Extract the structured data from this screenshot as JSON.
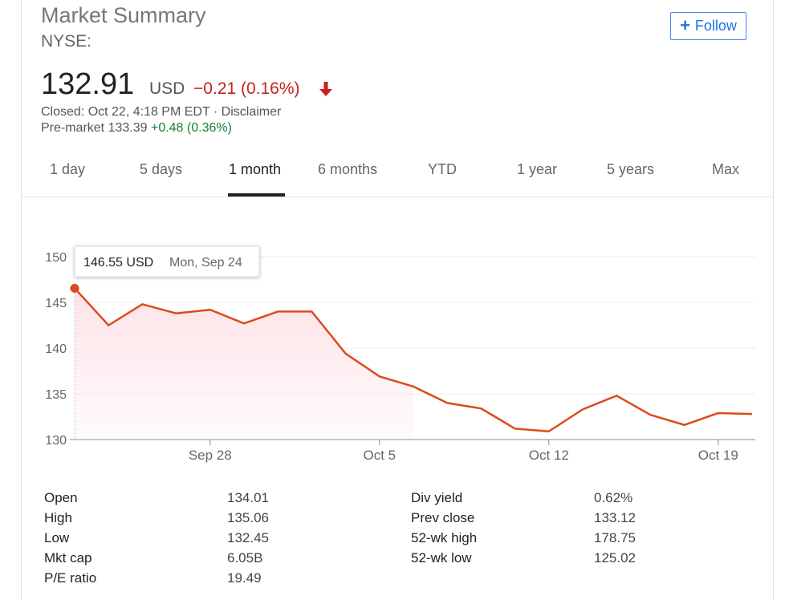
{
  "header": {
    "title": "Market Summary",
    "exchange": "NYSE:",
    "follow_label": "Follow"
  },
  "quote": {
    "price": "132.91",
    "currency": "USD",
    "change": "−0.21 (0.16%)",
    "closed_text": "Closed: Oct 22, 4:18 PM EDT · Disclaimer",
    "premarket_label": "Pre-market",
    "premarket_price": "133.39",
    "premarket_change": "+0.48 (0.36%)",
    "down_color": "#c5221f",
    "up_color": "#188038"
  },
  "tabs": [
    {
      "label": "1 day",
      "active": false
    },
    {
      "label": "5 days",
      "active": false
    },
    {
      "label": "1 month",
      "active": true
    },
    {
      "label": "6 months",
      "active": false
    },
    {
      "label": "YTD",
      "active": false
    },
    {
      "label": "1 year",
      "active": false
    },
    {
      "label": "5 years",
      "active": false
    },
    {
      "label": "Max",
      "active": false
    }
  ],
  "chart_data": {
    "type": "area",
    "ylim": [
      130,
      150
    ],
    "yticks": [
      130,
      135,
      140,
      145,
      150
    ],
    "x": [
      "Sep 24",
      "Sep 25",
      "Sep 26",
      "Sep 27",
      "Sep 28",
      "Oct 1",
      "Oct 2",
      "Oct 3",
      "Oct 4",
      "Oct 5",
      "Oct 8",
      "Oct 9",
      "Oct 10",
      "Oct 11",
      "Oct 12",
      "Oct 15",
      "Oct 16",
      "Oct 17",
      "Oct 18",
      "Oct 19",
      "Oct 22"
    ],
    "values": [
      146.55,
      142.5,
      144.8,
      143.8,
      144.2,
      142.7,
      144.0,
      144.0,
      139.4,
      136.9,
      135.8,
      134.0,
      133.4,
      131.2,
      130.9,
      133.3,
      134.8,
      132.7,
      131.6,
      132.9,
      132.8
    ],
    "xtick_labels": [
      {
        "label": "Sep 28",
        "index": 4
      },
      {
        "label": "Oct 5",
        "index": 9
      },
      {
        "label": "Oct 12",
        "index": 14
      },
      {
        "label": "Oct 19",
        "index": 19
      }
    ],
    "line_color": "#dd4b1b",
    "fill_color": "#fde3e8",
    "tooltip": {
      "value": "146.55 USD",
      "date": "Mon, Sep 24",
      "index": 0
    }
  },
  "stats": {
    "left": [
      {
        "label": "Open",
        "value": "134.01"
      },
      {
        "label": "High",
        "value": "135.06"
      },
      {
        "label": "Low",
        "value": "132.45"
      },
      {
        "label": "Mkt cap",
        "value": "6.05B"
      },
      {
        "label": "P/E ratio",
        "value": "19.49"
      }
    ],
    "right": [
      {
        "label": "Div yield",
        "value": "0.62%"
      },
      {
        "label": "Prev close",
        "value": "133.12"
      },
      {
        "label": "52-wk high",
        "value": "178.75"
      },
      {
        "label": "52-wk low",
        "value": "125.02"
      }
    ]
  }
}
